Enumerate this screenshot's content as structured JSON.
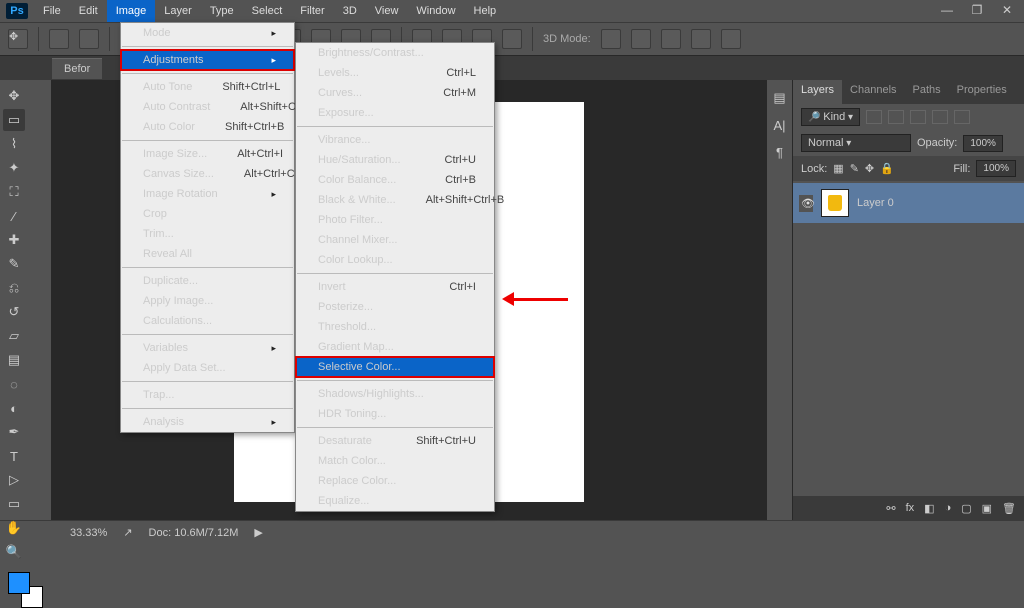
{
  "app": {
    "logo": "Ps"
  },
  "menubar": [
    "File",
    "Edit",
    "Image",
    "Layer",
    "Type",
    "Select",
    "Filter",
    "3D",
    "View",
    "Window",
    "Help"
  ],
  "open_menu_index": 2,
  "tab": {
    "label": "Befor"
  },
  "optionbar": {
    "mode3d": "3D Mode:"
  },
  "menu_image": {
    "groups": [
      [
        {
          "label": "Mode",
          "sub": true
        }
      ],
      [
        {
          "label": "Adjustments",
          "sub": true,
          "hl": true,
          "boxed": true
        }
      ],
      [
        {
          "label": "Auto Tone",
          "shortcut": "Shift+Ctrl+L"
        },
        {
          "label": "Auto Contrast",
          "shortcut": "Alt+Shift+Ctrl+L"
        },
        {
          "label": "Auto Color",
          "shortcut": "Shift+Ctrl+B"
        }
      ],
      [
        {
          "label": "Image Size...",
          "shortcut": "Alt+Ctrl+I"
        },
        {
          "label": "Canvas Size...",
          "shortcut": "Alt+Ctrl+C"
        },
        {
          "label": "Image Rotation",
          "sub": true
        },
        {
          "label": "Crop"
        },
        {
          "label": "Trim..."
        },
        {
          "label": "Reveal All"
        }
      ],
      [
        {
          "label": "Duplicate..."
        },
        {
          "label": "Apply Image..."
        },
        {
          "label": "Calculations..."
        }
      ],
      [
        {
          "label": "Variables",
          "sub": true
        },
        {
          "label": "Apply Data Set...",
          "dis": true
        }
      ],
      [
        {
          "label": "Trap...",
          "dis": true
        }
      ],
      [
        {
          "label": "Analysis",
          "sub": true
        }
      ]
    ]
  },
  "menu_adjustments": {
    "groups": [
      [
        {
          "label": "Brightness/Contrast..."
        },
        {
          "label": "Levels...",
          "shortcut": "Ctrl+L"
        },
        {
          "label": "Curves...",
          "shortcut": "Ctrl+M"
        },
        {
          "label": "Exposure..."
        }
      ],
      [
        {
          "label": "Vibrance..."
        },
        {
          "label": "Hue/Saturation...",
          "shortcut": "Ctrl+U"
        },
        {
          "label": "Color Balance...",
          "shortcut": "Ctrl+B"
        },
        {
          "label": "Black & White...",
          "shortcut": "Alt+Shift+Ctrl+B"
        },
        {
          "label": "Photo Filter..."
        },
        {
          "label": "Channel Mixer..."
        },
        {
          "label": "Color Lookup..."
        }
      ],
      [
        {
          "label": "Invert",
          "shortcut": "Ctrl+I"
        },
        {
          "label": "Posterize..."
        },
        {
          "label": "Threshold..."
        },
        {
          "label": "Gradient Map..."
        },
        {
          "label": "Selective Color...",
          "hl": true,
          "boxed": true
        }
      ],
      [
        {
          "label": "Shadows/Highlights..."
        },
        {
          "label": "HDR Toning...",
          "dis": true
        }
      ],
      [
        {
          "label": "Desaturate",
          "shortcut": "Shift+Ctrl+U"
        },
        {
          "label": "Match Color..."
        },
        {
          "label": "Replace Color..."
        },
        {
          "label": "Equalize..."
        }
      ]
    ]
  },
  "layers_panel": {
    "tabs": [
      "Layers",
      "Channels",
      "Paths",
      "Properties"
    ],
    "kind_filter": "Kind",
    "blend_mode": "Normal",
    "opacity_label": "Opacity:",
    "opacity_value": "100%",
    "lock_label": "Lock:",
    "fill_label": "Fill:",
    "fill_value": "100%",
    "layer_name": "Layer 0"
  },
  "status": {
    "zoom": "33.33%",
    "doc": "Doc: 10.6M/7.12M"
  }
}
